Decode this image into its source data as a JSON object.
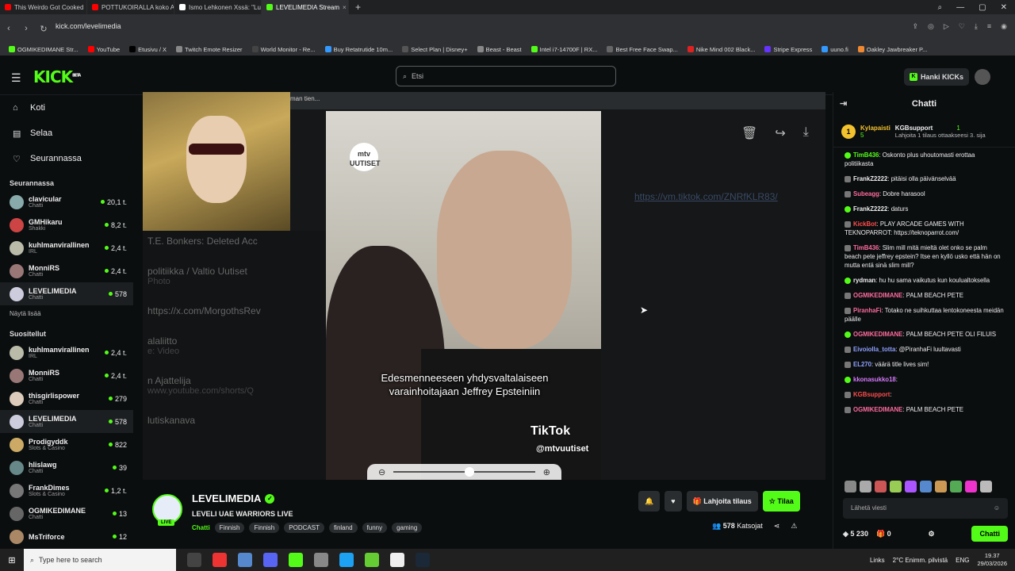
{
  "tabs": [
    {
      "label": "This Weirdo Got Cooked",
      "color": "#ff0000"
    },
    {
      "label": "POTTUKOIRALLA koko An",
      "color": "#ff0000"
    },
    {
      "label": "Ismo Lehkonen Xssä: \"Lu",
      "color": "#ffffff"
    },
    {
      "label": "LEVELIMEDIA Stream",
      "color": "#53fc18"
    }
  ],
  "url": "kick.com/levelimedia",
  "bookmarks": [
    "OGMIKEDIMANE Str...",
    "YouTube",
    "Etusivu / X",
    "Twitch Emote Resizer",
    "World Monitor - Re...",
    "Buy Retatrutide 10m...",
    "Select Plan | Disney+",
    "Beast - Beast",
    "Intel i7-14700F | RX...",
    "Best Free Face Swap...",
    "Nike Mind 002 Black...",
    "Stripe Express",
    "uuno.fi",
    "Oakley Jawbreaker P..."
  ],
  "search": {
    "placeholder": "Etsi"
  },
  "header": {
    "logo": "KICK",
    "logo_sup": "BETA",
    "hanki": "Hanki KICKs"
  },
  "nav": [
    {
      "label": "Koti",
      "icon": "home-icon",
      "glyph": "⌂"
    },
    {
      "label": "Selaa",
      "icon": "browse-icon",
      "glyph": "▤"
    },
    {
      "label": "Seurannassa",
      "icon": "heart-icon",
      "glyph": "♡"
    }
  ],
  "following": {
    "title": "Seurannassa",
    "items": [
      {
        "name": "clavicular",
        "cat": "Chatti",
        "views": "20,1 t.",
        "color": "#8aa"
      },
      {
        "name": "GMHikaru",
        "cat": "Shakki",
        "views": "8,2 t.",
        "color": "#c44"
      },
      {
        "name": "kuhlmanvirallinen",
        "cat": "IRL",
        "views": "2,4 t.",
        "color": "#bba"
      },
      {
        "name": "MonniRS",
        "cat": "Chatti",
        "views": "2,4 t.",
        "color": "#977"
      },
      {
        "name": "LEVELIMEDIA",
        "cat": "Chatti",
        "views": "578",
        "color": "#ccd"
      }
    ],
    "more": "Näytä lisää"
  },
  "recommended": {
    "title": "Suositellut",
    "items": [
      {
        "name": "kuhlmanvirallinen",
        "cat": "IRL",
        "views": "2,4 t.",
        "color": "#bba"
      },
      {
        "name": "MonniRS",
        "cat": "Chatti",
        "views": "2,4 t.",
        "color": "#977"
      },
      {
        "name": "thisgirlispower",
        "cat": "Chatti",
        "views": "279",
        "color": "#dcb"
      },
      {
        "name": "LEVELIMEDIA",
        "cat": "Chatti",
        "views": "578",
        "color": "#ccd"
      },
      {
        "name": "Prodigyddk",
        "cat": "Slots & Casino",
        "views": "822",
        "color": "#ca6"
      },
      {
        "name": "hlislawg",
        "cat": "Chatti",
        "views": "39",
        "color": "#688"
      },
      {
        "name": "FrankDimes",
        "cat": "Slots & Casino",
        "views": "1,2 t.",
        "color": "#777"
      },
      {
        "name": "OGMIKEDIMANE",
        "cat": "Chatti",
        "views": "13",
        "color": "#666"
      },
      {
        "name": "MsTriforce",
        "cat": "",
        "views": "12",
        "color": "#a86"
      }
    ]
  },
  "player": {
    "topstrip": "man tien...",
    "feed": [
      {
        "title": "T.E. Bonkers: Deleted Acc",
        "sub": ""
      },
      {
        "title": "politiikka / Valtio Uutiset",
        "sub": "Photo"
      },
      {
        "title": "https://x.com/MorgothsRev",
        "sub": ""
      },
      {
        "title": "alaliitto",
        "sub": "e: Video"
      },
      {
        "title": "n Ajattelija",
        "sub": "www.youtube.com/shorts/Q"
      },
      {
        "title": "lutiskanava",
        "sub": ""
      }
    ],
    "mtv": "mtv UUTISET",
    "subtitle": "Edesmenneeseen yhdysvaltalaiseen varainhoitajaan Jeffrey Epsteiniin",
    "tiktok_brand": "TikTok",
    "tiktok_user": "@mtvuutiset",
    "link": "https://vm.tiktok.com/ZNRfKLR83/",
    "zoom_level": 0.5
  },
  "channel": {
    "name": "LEVELIMEDIA",
    "live": "LIVE",
    "title": "LEVELI UAE WARRIORS LIVE",
    "category": "Chatti",
    "tags": [
      "Finnish",
      "Finnish",
      "PODCAST",
      "finland",
      "funny",
      "gaming"
    ],
    "gift": "Lahjoita tilaus",
    "subscribe": "Tilaa",
    "viewers": "578",
    "viewers_label": "Katsojat"
  },
  "chat": {
    "title": "Chatti",
    "pinned_user": "Kylapaisti",
    "pinned_count": "5",
    "pinned_sub_user": "KGBsupport",
    "pinned_sub_count": "1",
    "pinned_gift": "Lahjoita 1 tilaus ottaakseesi 3. sija",
    "messages": [
      {
        "user": "TimB436",
        "color": "#53fc18",
        "text": "Oskonto plus uhoutomasti erottaa politiikasta"
      },
      {
        "user": "FrankZ2222",
        "color": "#eeeeee",
        "text": "pitäisi olla päivänselvää"
      },
      {
        "user": "Subeagg",
        "color": "#ff6b9d",
        "text": "Dobre harasool"
      },
      {
        "user": "FrankZ2222",
        "color": "#eeeeee",
        "text": "daturs"
      },
      {
        "user": "KickBot",
        "color": "#ff4d4d",
        "text": "PLAY ARCADE GAMES WITH TEKNOPARROT: https://teknoparrot.com/"
      },
      {
        "user": "TimB436",
        "color": "#ff6b9d",
        "text": "Slim mill mitä mieltä olet onko se palm beach pete jeffrey epstein? Itse en kyllö usko että hän on mutta entä sinä slim mill?"
      },
      {
        "user": "rydman",
        "color": "#eeeeee",
        "text": "hu hu sama vaikutus kun koulualtoksella"
      },
      {
        "user": "OGMIKEDIMANE",
        "color": "#ff6b9d",
        "text": "PALM BEACH PETE"
      },
      {
        "user": "PiranhaFi",
        "color": "#ff6b9d",
        "text": "Totako ne suihkuttaa lentokoneesta meidän päälle"
      },
      {
        "user": "OGMIKEDIMANE",
        "color": "#ff6b9d",
        "text": "PALM BEACH PETE OLI FILUIS"
      },
      {
        "user": "Eivoiolla_totta",
        "color": "#8ea0ff",
        "text": "@PiranhaFi luultavasti"
      },
      {
        "user": "EL270",
        "color": "#8ea0ff",
        "text": "väärä title lives sim!"
      },
      {
        "user": "kkonasukko18",
        "color": "#d77aff",
        "text": ""
      },
      {
        "user": "KGBsupport",
        "color": "#ff4d4d",
        "text": ""
      },
      {
        "user": "OGMIKEDIMANE",
        "color": "#ff6b9d",
        "text": "PALM BEACH PETE"
      }
    ],
    "input_placeholder": "Lähetä viesti",
    "points": "5 230",
    "gifts": "0",
    "send": "Chatti"
  },
  "taskbar": {
    "search": "Type here to search",
    "links": "Links",
    "weather": "2°C Enimm. pilvistä",
    "lang": "ENG",
    "time": "19.37",
    "date": "29/03/2026"
  }
}
